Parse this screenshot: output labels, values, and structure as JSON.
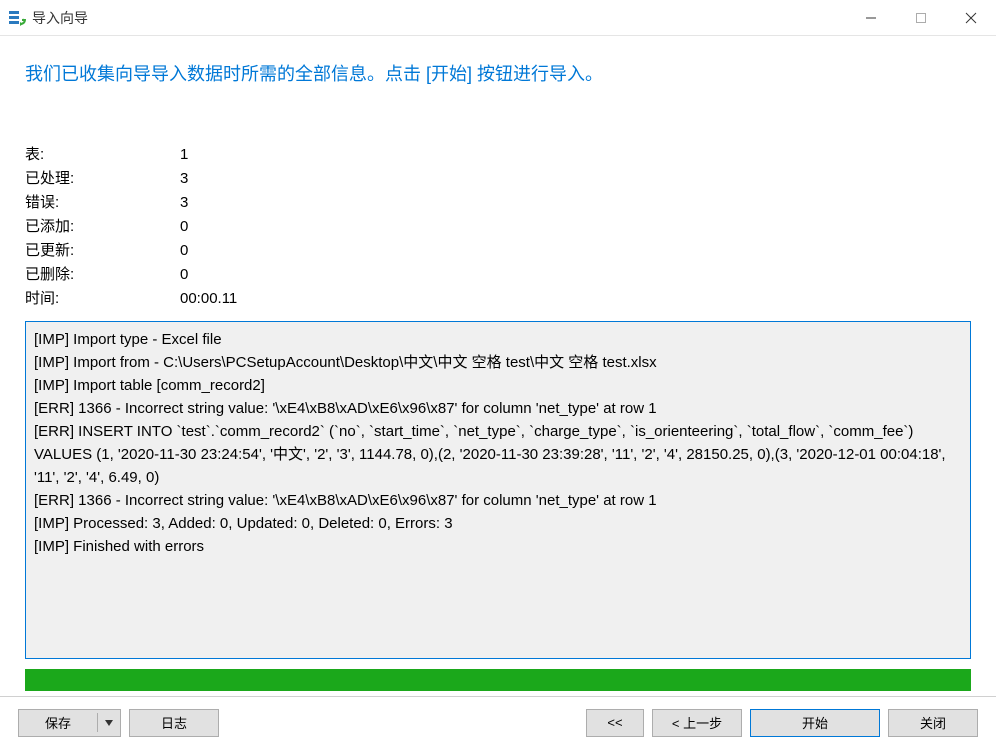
{
  "window": {
    "title": "导入向导"
  },
  "header": {
    "message": "我们已收集向导导入数据时所需的全部信息。点击 [开始] 按钮进行导入。"
  },
  "stats": {
    "table_label": "表:",
    "table_value": "1",
    "processed_label": "已处理:",
    "processed_value": "3",
    "errors_label": "错误:",
    "errors_value": "3",
    "added_label": "已添加:",
    "added_value": "0",
    "updated_label": "已更新:",
    "updated_value": "0",
    "deleted_label": "已删除:",
    "deleted_value": "0",
    "time_label": "时间:",
    "time_value": "00:00.11"
  },
  "log": {
    "line1": "[IMP] Import type - Excel file",
    "line2": "[IMP] Import from - C:\\Users\\PCSetupAccount\\Desktop\\中文\\中文 空格 test\\中文 空格 test.xlsx",
    "line3": "[IMP] Import table [comm_record2]",
    "line4": "[ERR] 1366 - Incorrect string value: '\\xE4\\xB8\\xAD\\xE6\\x96\\x87' for column 'net_type' at row 1",
    "line5": "[ERR] INSERT INTO `test`.`comm_record2` (`no`, `start_time`, `net_type`, `charge_type`, `is_orienteering`, `total_flow`, `comm_fee`) VALUES (1, '2020-11-30 23:24:54', '中文', '2', '3', 1144.78, 0),(2, '2020-11-30 23:39:28', '11', '2', '4', 28150.25, 0),(3, '2020-12-01 00:04:18', '11', '2', '4', 6.49, 0)",
    "line6": "[ERR] 1366 - Incorrect string value: '\\xE4\\xB8\\xAD\\xE6\\x96\\x87' for column 'net_type' at row 1",
    "line7": "[IMP] Processed: 3, Added: 0, Updated: 0, Deleted: 0, Errors: 3",
    "line8": "[IMP] Finished with errors"
  },
  "footer": {
    "save": "保存",
    "log": "日志",
    "prev_first": "<<",
    "prev": "< 上一步",
    "start": "开始",
    "close": "关闭"
  }
}
